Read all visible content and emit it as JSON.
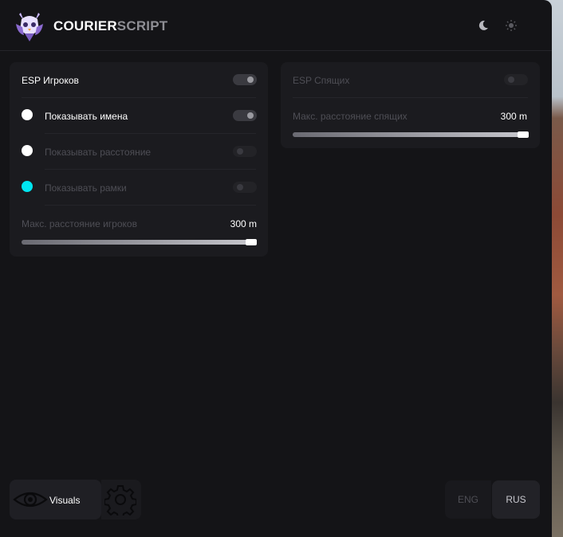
{
  "brand": {
    "part1": "COURIER",
    "part2": "SCRIPT"
  },
  "header": {
    "icons": [
      "moon-icon",
      "sun-icon"
    ]
  },
  "esp_players": {
    "title": "ESP Игроков",
    "enabled": true,
    "options": [
      {
        "label": "Показывать имена",
        "color": "#ffffff",
        "enabled": true
      },
      {
        "label": "Показывать расстояние",
        "color": "#ffffff",
        "enabled": false
      },
      {
        "label": "Показывать рамки",
        "color": "#00e5f0",
        "enabled": false
      }
    ],
    "distance_label": "Макс. расстояние игроков",
    "distance_value": "300 m",
    "distance_fraction": 1.0
  },
  "esp_sleepers": {
    "title": "ESP Спящих",
    "enabled": false,
    "distance_label": "Макс. расстояние спящих",
    "distance_value": "300 m",
    "distance_fraction": 1.0
  },
  "nav": {
    "visuals_label": "Visuals",
    "visuals_icon": "eye-icon",
    "settings_icon": "gear-icon"
  },
  "language": {
    "options": [
      "ENG",
      "RUS"
    ],
    "selected": "RUS"
  }
}
